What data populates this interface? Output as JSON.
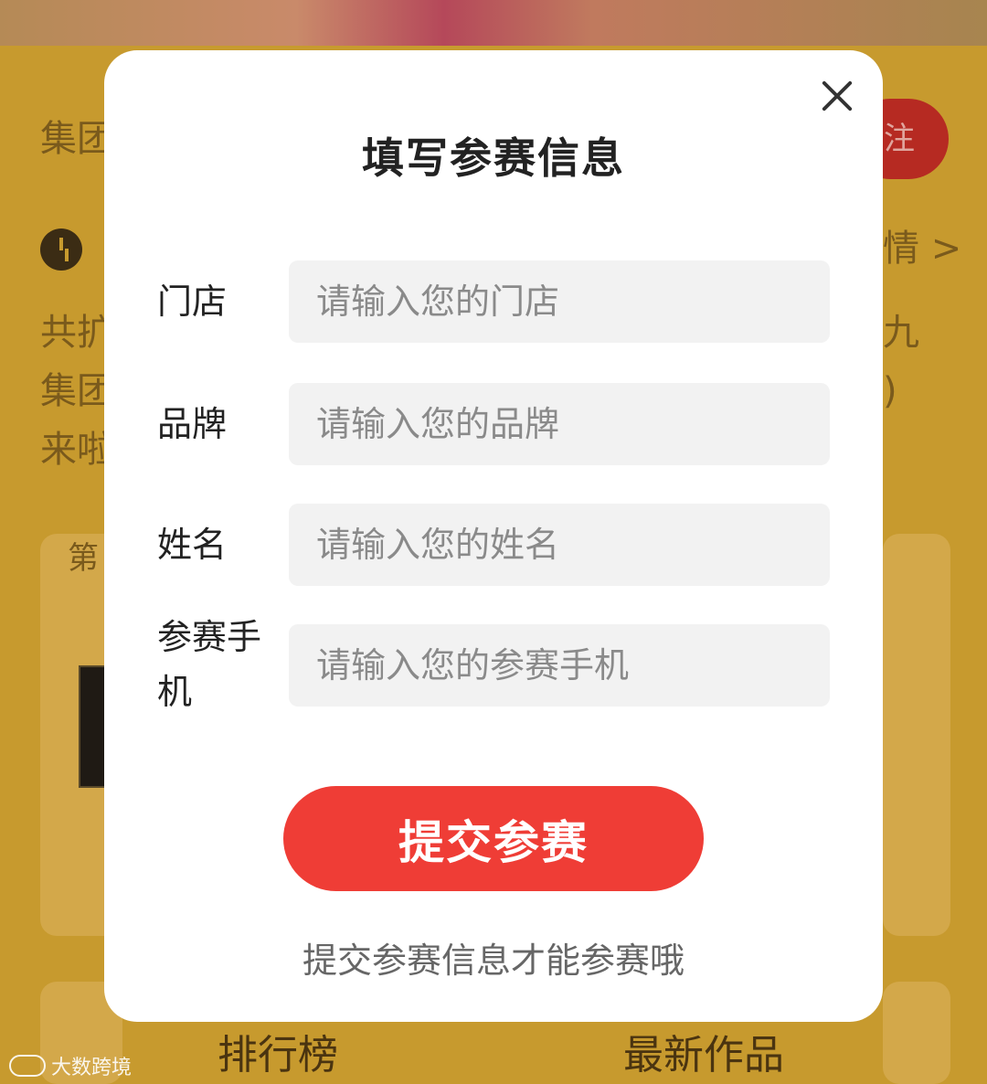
{
  "background": {
    "group_label_1": "集团",
    "follow_button": "注",
    "details_link": "情 >",
    "line_1_left": "共扩",
    "line_1_right": "九",
    "line_2_left": "集团",
    "line_2_right": ")",
    "line_3_left": "来啦",
    "card_label": "第",
    "tabs": [
      "排行榜",
      "最新作品"
    ],
    "watermark": "大数跨境"
  },
  "modal": {
    "title": "填写参赛信息",
    "fields": [
      {
        "label": "门店",
        "placeholder": "请输入您的门店",
        "value": ""
      },
      {
        "label": "品牌",
        "placeholder": "请输入您的品牌",
        "value": ""
      },
      {
        "label": "姓名",
        "placeholder": "请输入您的姓名",
        "value": ""
      },
      {
        "label": "参赛手机",
        "placeholder": "请输入您的参赛手机",
        "value": ""
      }
    ],
    "submit_label": "提交参赛",
    "hint": "提交参赛信息才能参赛哦"
  },
  "colors": {
    "accent": "#ef3d36",
    "overlay_background": "#c79a2e"
  }
}
